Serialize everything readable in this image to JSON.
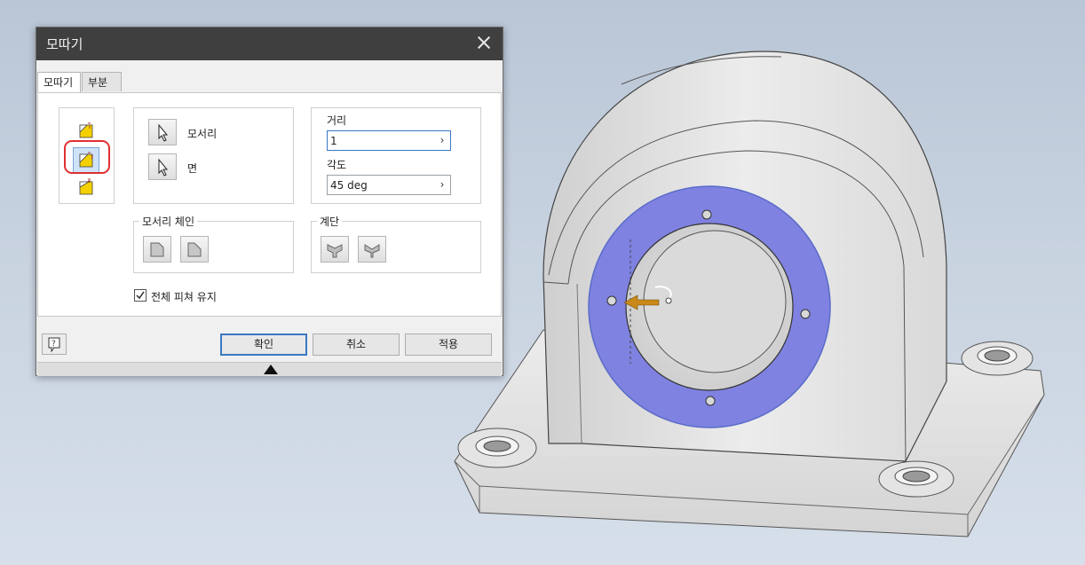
{
  "dialog": {
    "title": "모따기",
    "tabs": [
      "모따기",
      "부분"
    ],
    "mode_icons": [
      "chamfer-distance-icon",
      "chamfer-distance-angle-icon",
      "chamfer-two-distances-icon"
    ],
    "selected_mode_index": 1,
    "selectors": {
      "edges_label": "모서리",
      "face_label": "면"
    },
    "distance": {
      "label": "거리",
      "value": "1"
    },
    "angle": {
      "label": "각도",
      "value": "45 deg"
    },
    "edge_chain": {
      "label": "모서리 체인"
    },
    "setback": {
      "label": "계단"
    },
    "preserve_all_features": {
      "label": "전체 피쳐 유지",
      "checked": true
    },
    "buttons": {
      "ok": "확인",
      "cancel": "취소",
      "apply": "적용"
    }
  },
  "colors": {
    "title_bar": "#3f3f3f",
    "selection_face": "#7f82e0",
    "arrow": "#c8891a",
    "focus_border": "#3b78c4",
    "highlight_ring": "#e03030"
  }
}
